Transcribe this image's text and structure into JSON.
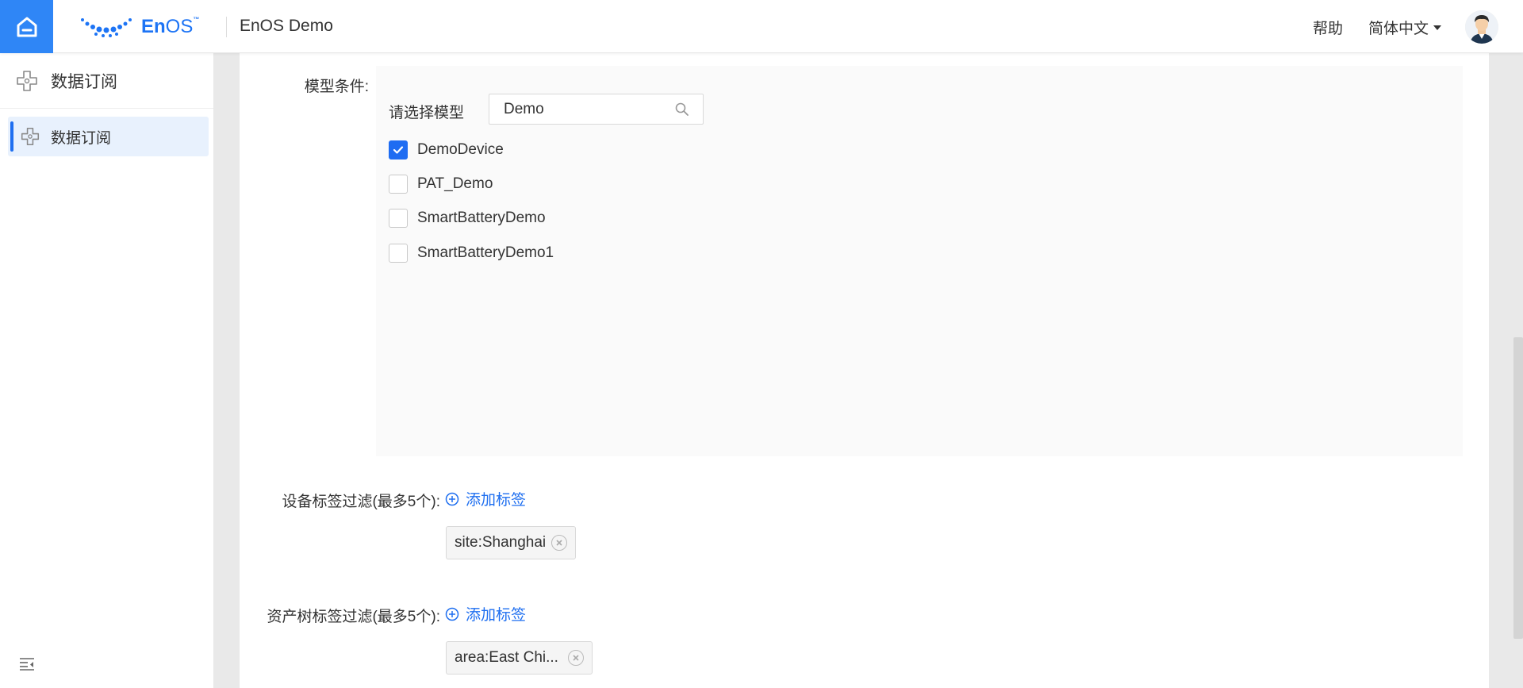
{
  "header": {
    "logo_main": "En",
    "logo_os": "OS",
    "logo_tm": "™",
    "app_title": "EnOS Demo",
    "help_label": "帮助",
    "language": "简体中文"
  },
  "sidebar": {
    "title": "数据订阅",
    "items": [
      {
        "label": "数据订阅"
      }
    ]
  },
  "form": {
    "model_condition_label": "模型条件:",
    "select_model_label": "请选择模型",
    "search_value": "Demo",
    "models": [
      {
        "label": "DemoDevice",
        "checked": true
      },
      {
        "label": "PAT_Demo",
        "checked": false
      },
      {
        "label": "SmartBatteryDemo",
        "checked": false
      },
      {
        "label": "SmartBatteryDemo1",
        "checked": false
      }
    ],
    "device_tag_label": "设备标签过滤(最多5个):",
    "device_add_tag": "添加标签",
    "device_tags": [
      "site:Shanghai"
    ],
    "asset_tree_tag_label": "资产树标签过滤(最多5个):",
    "asset_add_tag": "添加标签",
    "asset_tags": [
      "area:East Chi..."
    ]
  },
  "colors": {
    "primary": "#1f6ff0",
    "home_bg": "#2f86f6"
  }
}
